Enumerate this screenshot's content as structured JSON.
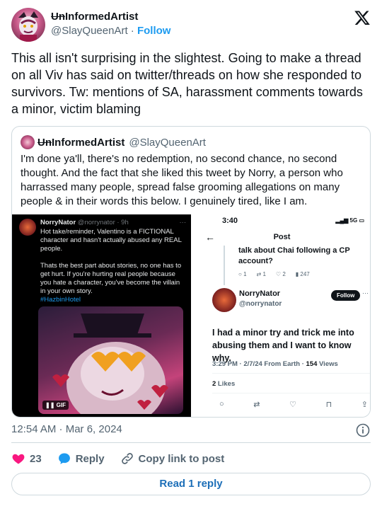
{
  "author": {
    "name_prefix": "Un",
    "name_rest": "InformedArtist",
    "handle": "@SlayQueenArt",
    "separator": "·",
    "follow_label": "Follow"
  },
  "tweet_text": "This all isn't surprising in the slightest. Going to make a thread on all Viv has said on twitter/threads on how she responded to survivors. Tw: mentions of SA, harassment comments towards a minor, victim blaming",
  "quote": {
    "name_prefix": "Un",
    "name_rest": "InformedArtist",
    "handle": "@SlayQueenArt",
    "text": "I'm done ya'll, there's no redemption, no second chance, no second thought. And the fact that she liked this tweet by Norry, a person who harrassed many people, spread false grooming allegations on many people & in their words this below. I genuinely tired, like I am.",
    "media_left": {
      "name": "NorryNator",
      "handle": "@norrynator · 9h",
      "dots": "···",
      "body1": "Hot take/reminder, Valentino is a FICTIONAL character and hasn't actually abused any REAL people.",
      "body2": "Thats the best part about stories, no one has to get hurt. If you're hurting real people because you hate a character, you've become the villain in your own story.",
      "hashtag": "#HazbinHotel",
      "gif_badge": "❚❚ GIF"
    },
    "media_right": {
      "time": "3:40",
      "status_right": "5G",
      "post_title": "Post",
      "prev_text": "talk about Chai following a CP account?",
      "prev_actions": [
        "1",
        "1",
        "2",
        "247"
      ],
      "name": "NorryNator",
      "handle": "@norrynator",
      "follow": "Follow",
      "dots": "···",
      "text": "I had a minor try and trick me into abusing them and I want to know why.",
      "meta_time": "3:29 PM · 2/7/24 From Earth · ",
      "meta_views_num": "154",
      "meta_views_label": " Views",
      "likes_num": "2",
      "likes_label": " Likes"
    }
  },
  "timestamp": "12:54 AM · Mar 6, 2024",
  "actions": {
    "like_count": "23",
    "reply_label": "Reply",
    "copy_label": "Copy link to post"
  },
  "read_reply_label": "Read 1 reply",
  "colors": {
    "accent": "#1d9bf0",
    "like": "#f91880",
    "text": "#0f1419",
    "muted": "#536471",
    "border": "#cfd9de"
  }
}
